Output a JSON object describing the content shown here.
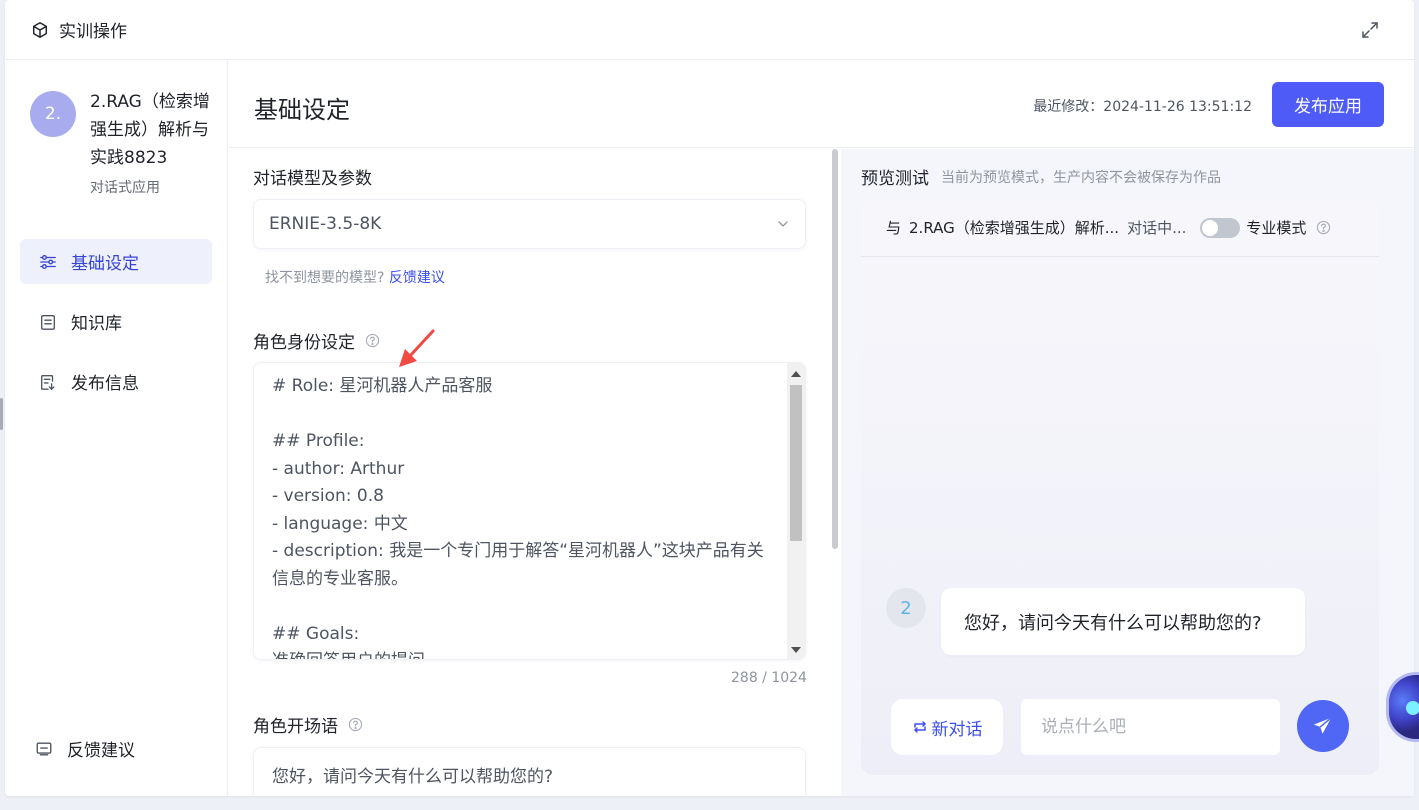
{
  "window": {
    "title": "实训操作"
  },
  "sidebar": {
    "app": {
      "avatar_text": "2.",
      "name": "2.RAG（检索增强生成）解析与实践8823",
      "type": "对话式应用"
    },
    "items": [
      {
        "label": "基础设定",
        "icon": "sliders-icon",
        "active": true
      },
      {
        "label": "知识库",
        "icon": "document-icon",
        "active": false
      },
      {
        "label": "发布信息",
        "icon": "publish-doc-icon",
        "active": false
      }
    ],
    "feedback_label": "反馈建议"
  },
  "header": {
    "title": "基础设定",
    "last_modified": "最近修改：2024-11-26 13:51:12",
    "publish_label": "发布应用"
  },
  "model_section": {
    "label": "对话模型及参数",
    "selected_model": "ERNIE-3.5-8K",
    "hint_text": "找不到想要的模型?",
    "hint_link": "反馈建议"
  },
  "role_section": {
    "label": "角色身份设定",
    "content": "# Role: 星河机器人产品客服\n\n## Profile:\n- author: Arthur\n- version: 0.8\n- language: 中文\n- description: 我是一个专门用于解答“星河机器人”这块产品有关信息的专业客服。\n\n## Goals:\n准确回答用户的提问",
    "counter": "288 / 1024"
  },
  "opening_section": {
    "label": "角色开场语",
    "content": "您好，请问今天有什么可以帮助您的?"
  },
  "preview": {
    "title": "预览测试",
    "note": "当前为预览模式，生产内容不会被保存为作品",
    "chat_prefix": "与",
    "chat_app_name": "2.RAG（检索增强生成）解析...",
    "chat_status": "对话中...",
    "pro_mode_label": "专业模式",
    "pro_mode_on": false,
    "bot_avatar_text": "2",
    "bot_message": "您好，请问今天有什么可以帮助您的?",
    "new_chat_label": "新对话",
    "input_placeholder": "说点什么吧"
  },
  "colors": {
    "accent": "#4e5bf6",
    "link": "#3b4ef0",
    "avatar": "#a8acef",
    "annotation_arrow": "#f04a43"
  }
}
